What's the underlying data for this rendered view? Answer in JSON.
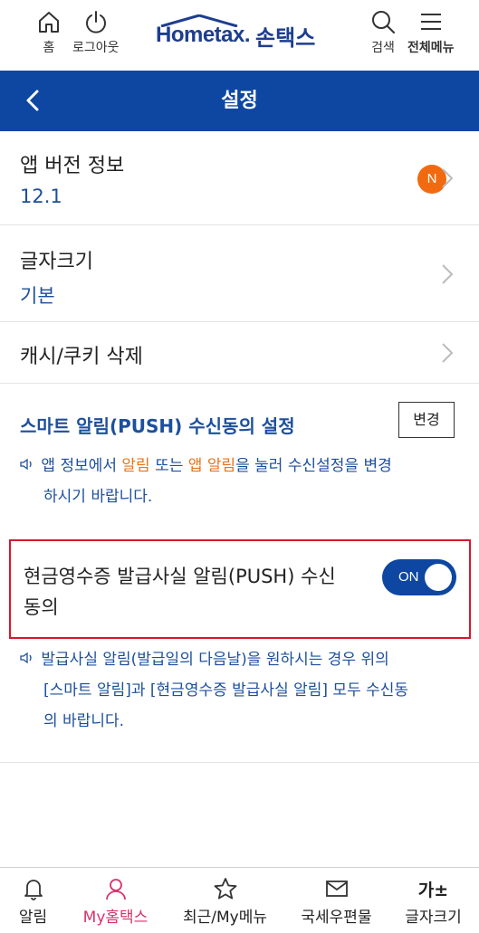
{
  "header": {
    "home_label": "홈",
    "logout_label": "로그아웃",
    "logo_text": "Hometax.",
    "logo_text_kr": "손택스",
    "search_label": "검색",
    "menu_label": "전체메뉴"
  },
  "titlebar": {
    "title": "설정"
  },
  "settings": {
    "version_title": "앱 버전 정보",
    "version_value": "12.1",
    "new_badge": "N",
    "font_title": "글자크기",
    "font_value": "기본",
    "cache_title": "캐시/쿠키 삭제"
  },
  "push": {
    "section_title": "스마트 알림(PUSH) 수신동의 설정",
    "change_label": "변경",
    "note1_a": "앱 정보에서 ",
    "note1_hl1": "알림",
    "note1_b": " 또는 ",
    "note1_hl2": "앱 알림",
    "note1_c": "을 눌러 수신설정을 변경",
    "note1_line2": "하시기 바랍니다.",
    "receipt_title": "현금영수증 발급사실 알림(PUSH) 수신 동의",
    "toggle_label": "ON",
    "note2_line1": "발급사실 알림(발급일의 다음날)을 원하시는 경우 위의",
    "note2_line2": "[스마트 알림]과 [현금영수증 발급사실 알림] 모두 수신동",
    "note2_line3": "의 바랍니다."
  },
  "bottom_nav": {
    "alarm": "알림",
    "my_hometax": "My홈택스",
    "recent": "최근/My메뉴",
    "mail": "국세우편물",
    "font_size": "글자크기",
    "font_icon": "가±"
  },
  "colors": {
    "primary": "#0d47a1",
    "link_text": "#1d4f9c",
    "badge": "#f26a0f",
    "highlight": "#e8741e",
    "active_nav": "#d6336c",
    "red_outline": "#d8182b"
  }
}
